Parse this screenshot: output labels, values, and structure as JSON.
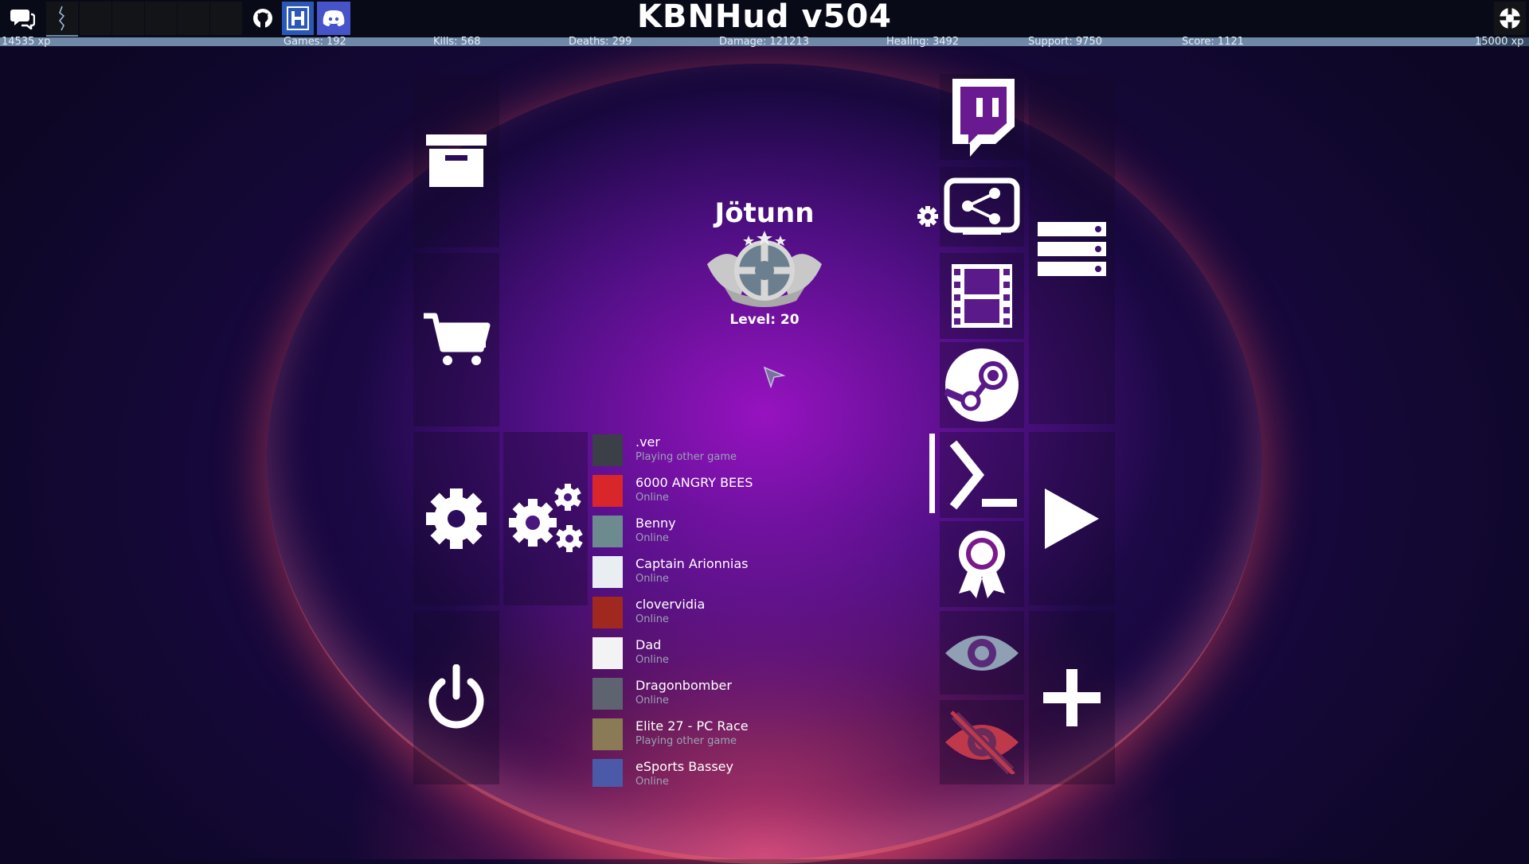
{
  "app": {
    "title": "KBNHud v504"
  },
  "xp": {
    "current": "14535 xp",
    "max": "15000 xp",
    "progress": 0.969
  },
  "stats": [
    "Games: 192",
    "Kills: 568",
    "Deaths: 299",
    "Damage: 121213",
    "Healing: 3492",
    "Support: 9750",
    "Score: 1121"
  ],
  "topbar_icons": [
    "chat-icon",
    "tf2-class-icon",
    "github-icon",
    "hud-h-icon",
    "discord-icon",
    "tf2-logo-icon"
  ],
  "profile": {
    "name": "Jötunn",
    "level": "Level: 20"
  },
  "left_tiles": [
    "archive-icon",
    "cart-icon",
    "gear-icon",
    "multi-gear-icon",
    "power-icon"
  ],
  "right_tiles": [
    "twitch-icon",
    "settings-small-icon",
    "server-share-icon",
    "server-list-icon",
    "film-icon",
    "steam-icon",
    "console-icon",
    "play-icon",
    "achievement-icon",
    "eye-icon",
    "eye-slash-icon",
    "plus-icon"
  ],
  "friends": [
    {
      "name": ".ver",
      "status": "Playing other game",
      "avatar": "#3b3f48"
    },
    {
      "name": "6000 ANGRY BEES",
      "status": "Online",
      "avatar": "#d9262b"
    },
    {
      "name": "Benny",
      "status": "Online",
      "avatar": "#6d8b8f"
    },
    {
      "name": "Captain Arionnias",
      "status": "Online",
      "avatar": "#e9eef2"
    },
    {
      "name": "clovervidia",
      "status": "Online",
      "avatar": "#a0281e"
    },
    {
      "name": "Dad",
      "status": "Online",
      "avatar": "#f3f3f3"
    },
    {
      "name": "Dragonbomber",
      "status": "Online",
      "avatar": "#5d6470"
    },
    {
      "name": "Elite 27 - PC Race",
      "status": "Playing other game",
      "avatar": "#8a7a55"
    },
    {
      "name": "eSports Bassey",
      "status": "Online",
      "avatar": "#4a5aa8"
    }
  ],
  "colors": {
    "hud_bg": "#080a18",
    "xp_bar": "#3a4d68",
    "hide_icon": "#c0394b",
    "eye_icon": "#8fa0b4",
    "discord": "#5865f2",
    "hud_button": "#2a57b8"
  }
}
